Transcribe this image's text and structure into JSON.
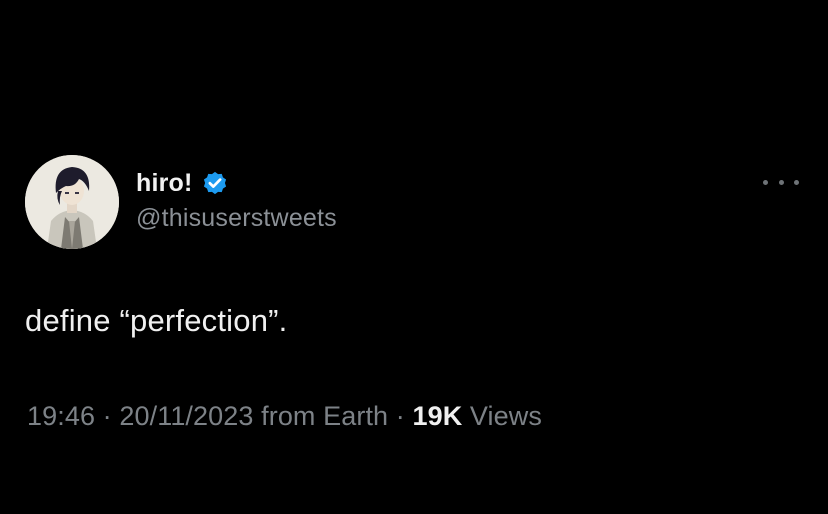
{
  "user": {
    "display_name": "hiro!",
    "handle": "@thisuserstweets",
    "verified": true
  },
  "tweet": {
    "text": "define “perfection”.",
    "time": "19:46",
    "date": "20/11/2023",
    "source": "from Earth",
    "separator": " · ",
    "views_count": "19K",
    "views_label": "Views"
  },
  "icons": {
    "verified": "verified-badge-icon",
    "more": "more-options-icon"
  },
  "colors": {
    "background": "#000000",
    "verified_badge": "#1d9bf0"
  }
}
